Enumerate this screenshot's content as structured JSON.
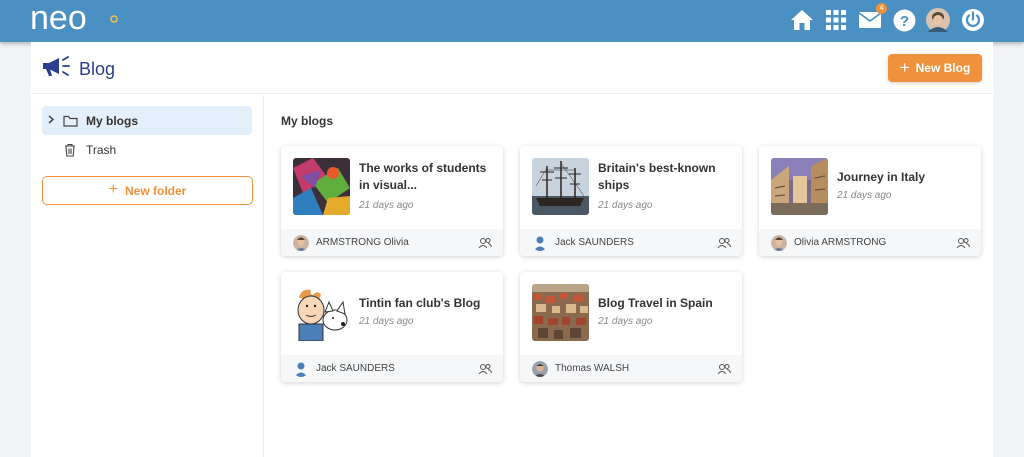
{
  "app": {
    "logo_text": "neo"
  },
  "topbar": {
    "icons": [
      "home-icon",
      "apps-grid-icon",
      "mail-icon",
      "help-icon",
      "user-avatar",
      "power-icon"
    ],
    "mail_badge": "4"
  },
  "header": {
    "title": "Blog",
    "new_blog_label": "New Blog"
  },
  "sidebar": {
    "items": [
      {
        "label": "My blogs",
        "icon": "folder-icon",
        "active": true
      },
      {
        "label": "Trash",
        "icon": "trash-icon",
        "active": false
      }
    ],
    "new_folder_label": "New folder"
  },
  "main": {
    "section_title": "My blogs",
    "blogs": [
      {
        "title": "The works of students in visual...",
        "date": "21 days ago",
        "author": "ARMSTRONG Olivia"
      },
      {
        "title": "Britain's best-known ships",
        "date": "21 days ago",
        "author": "Jack SAUNDERS"
      },
      {
        "title": "Journey in Italy",
        "date": "21 days ago",
        "author": "Olivia ARMSTRONG"
      },
      {
        "title": "Tintin fan club's Blog",
        "date": "21 days ago",
        "author": "Jack SAUNDERS"
      },
      {
        "title": "Blog Travel in Spain",
        "date": "21 days ago",
        "author": "Thomas WALSH"
      }
    ]
  },
  "colors": {
    "topbar": "#4a90c2",
    "accent": "#f0923c",
    "title": "#2c3e8f",
    "active_bg": "#e3effa"
  }
}
